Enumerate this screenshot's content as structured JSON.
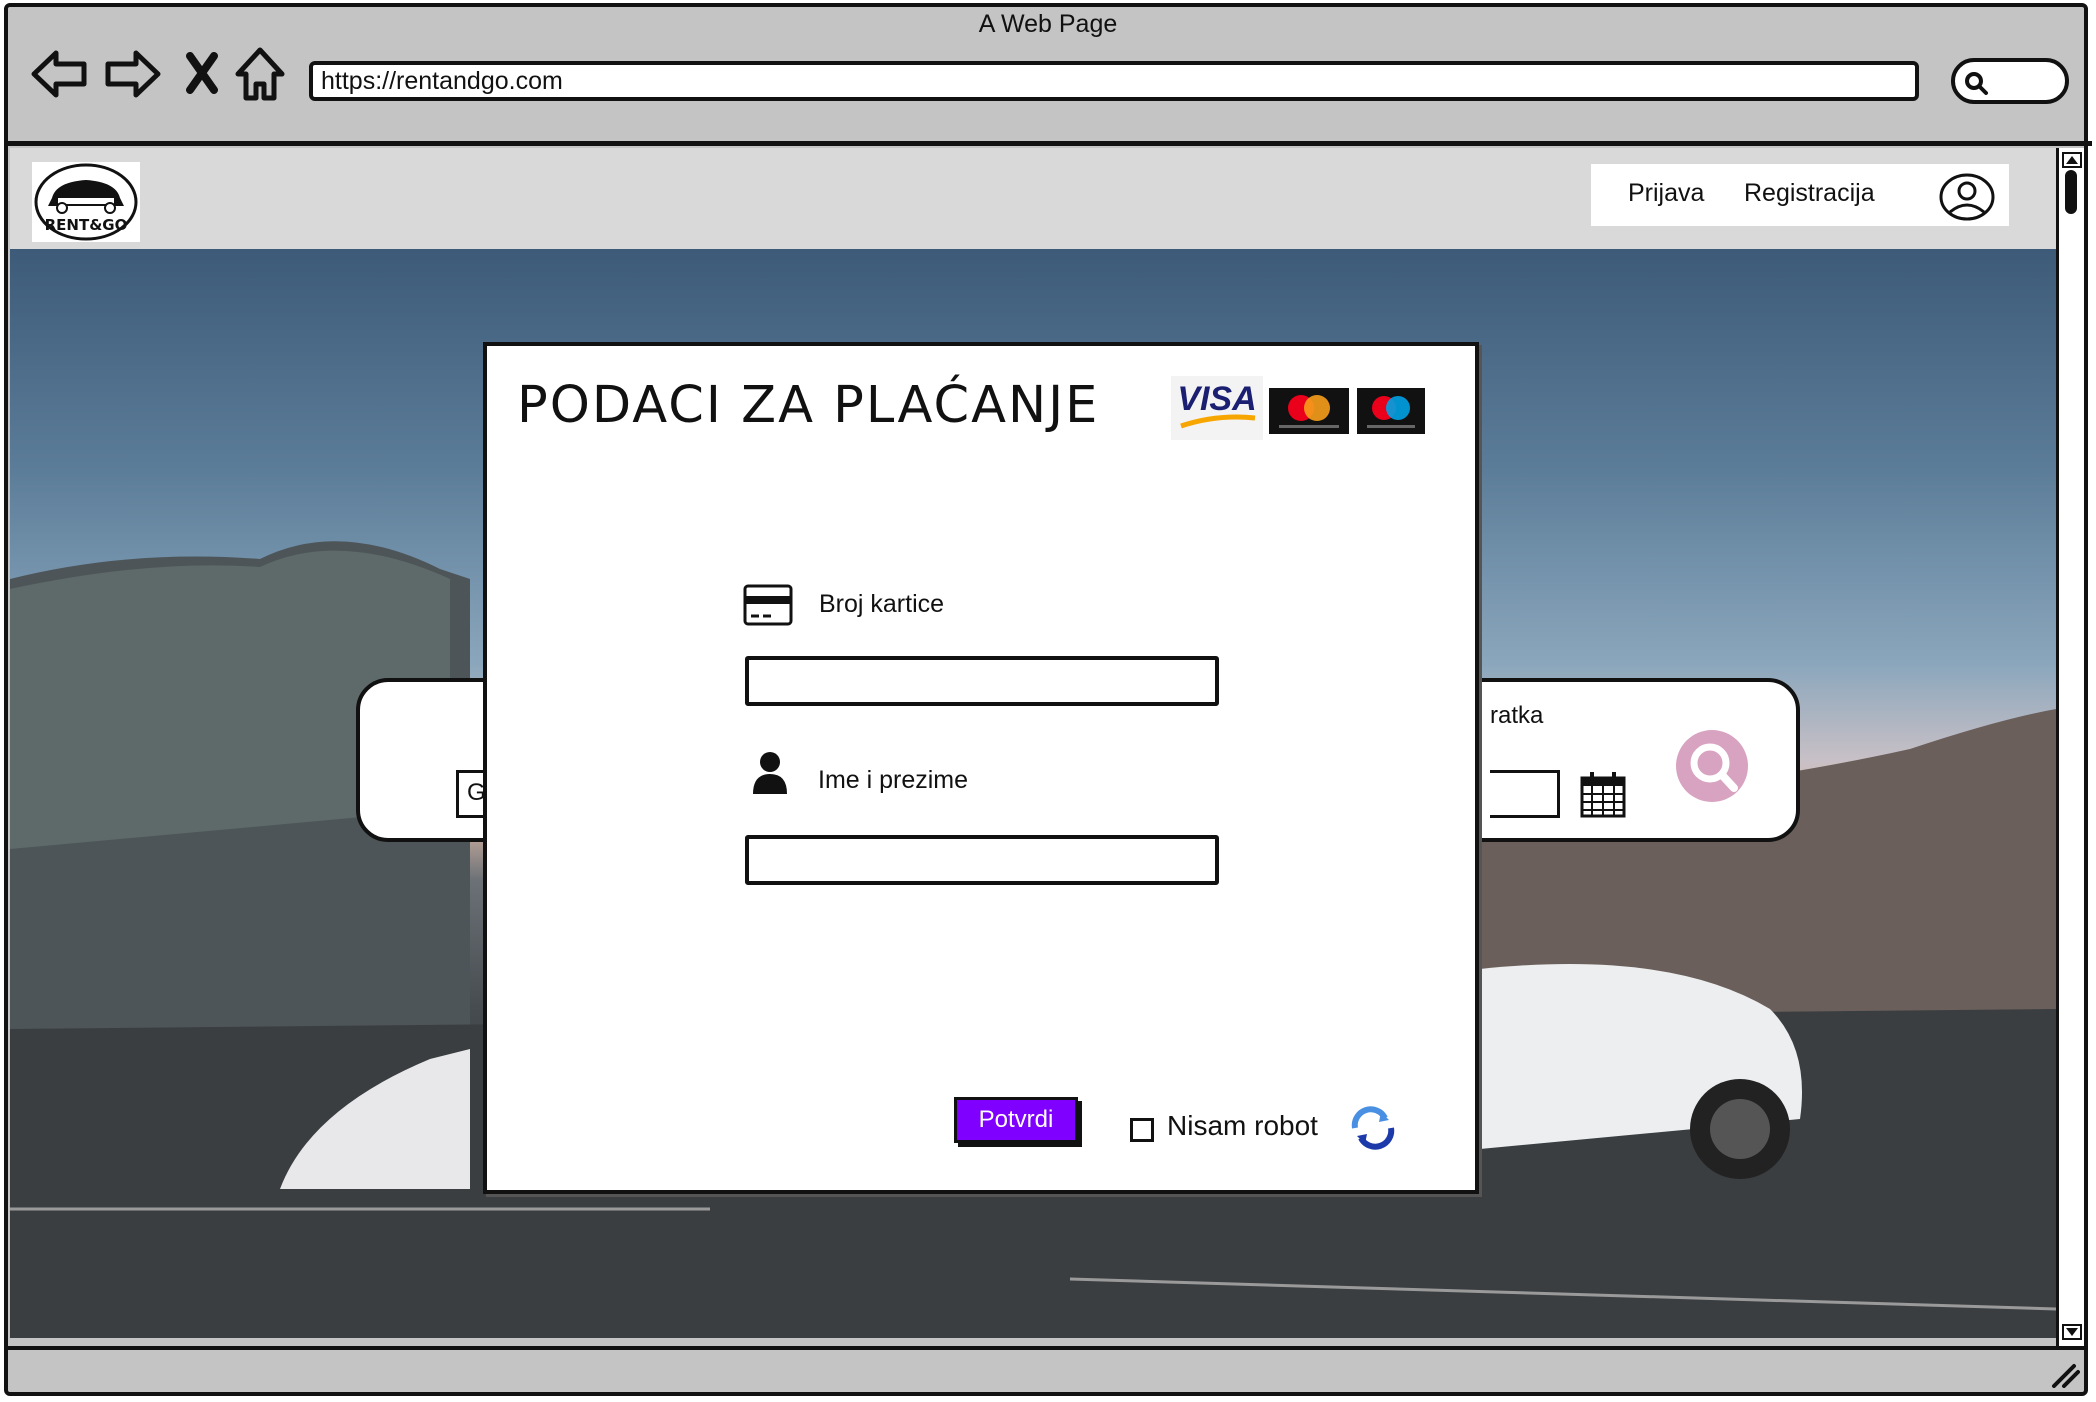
{
  "browser": {
    "title": "A Web Page",
    "url": "https://rentandgo.com"
  },
  "header": {
    "logo_text": "RENT&GO",
    "links": [
      "Prijava",
      "Registracija"
    ]
  },
  "search_panel": {
    "location_placeholder_partial": "Gr",
    "return_label_partial": "ratka"
  },
  "modal": {
    "title": "PODACI ZA PLAĆANJE",
    "card_logos": [
      "VISA",
      "mastercard",
      "maestro"
    ],
    "card_number_label": "Broj kartice",
    "name_label": "Ime i prezime",
    "confirm_label": "Potvrdi",
    "robot_label": "Nisam robot"
  },
  "colors": {
    "accent": "#7f00ff",
    "search_icon": "#d8a3c0"
  }
}
